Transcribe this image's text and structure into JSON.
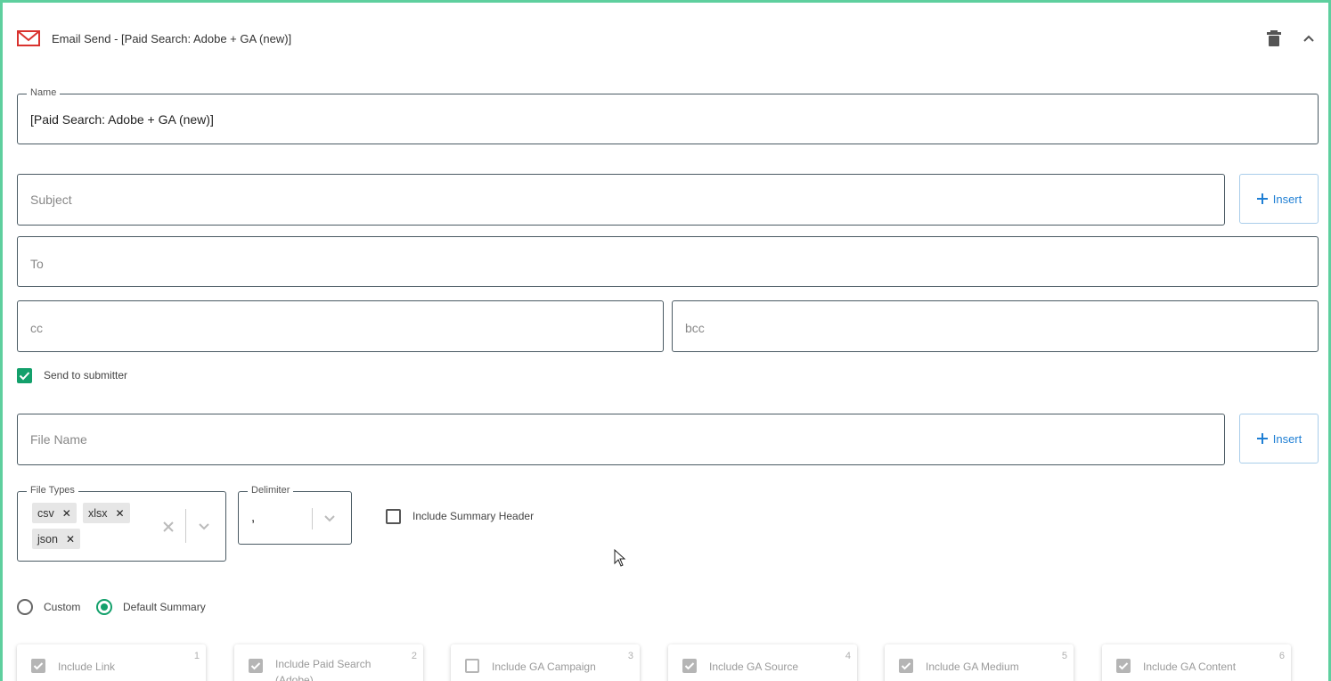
{
  "header": {
    "title": "Email Send - [Paid Search: Adobe + GA (new)]",
    "icons": {
      "mail": "mail-icon",
      "trash": "trash-icon",
      "collapse": "chevron-up-icon"
    }
  },
  "name_field": {
    "legend": "Name",
    "value": "[Paid Search: Adobe + GA (new)]"
  },
  "subject_field": {
    "placeholder": "Subject"
  },
  "to_field": {
    "placeholder": "To"
  },
  "cc_field": {
    "placeholder": "cc"
  },
  "bcc_field": {
    "placeholder": "bcc"
  },
  "insert_label": "Insert",
  "send_to_submitter": {
    "label": "Send to submitter",
    "checked": true
  },
  "file_name_field": {
    "placeholder": "File Name"
  },
  "file_types": {
    "legend": "File Types",
    "chips": [
      "csv",
      "xlsx",
      "json"
    ]
  },
  "delimiter": {
    "legend": "Delimiter",
    "value": ","
  },
  "include_summary_header": {
    "label": "Include Summary Header",
    "checked": false
  },
  "summary_mode": {
    "options": [
      "Custom",
      "Default Summary"
    ],
    "selected": "Default Summary"
  },
  "columns": [
    {
      "label": "Include Link",
      "num": "1",
      "checked": true
    },
    {
      "label": "Include Paid Search (Adobe)",
      "num": "2",
      "checked": true
    },
    {
      "label": "Include GA Campaign",
      "num": "3",
      "checked": false
    },
    {
      "label": "Include GA Source",
      "num": "4",
      "checked": true
    },
    {
      "label": "Include GA Medium",
      "num": "5",
      "checked": true
    },
    {
      "label": "Include GA Content",
      "num": "6",
      "checked": true
    }
  ],
  "colors": {
    "accent": "#13a06b",
    "frame": "#5ecf9e",
    "link": "#1f7fd4",
    "mail_red": "#d9322e"
  }
}
